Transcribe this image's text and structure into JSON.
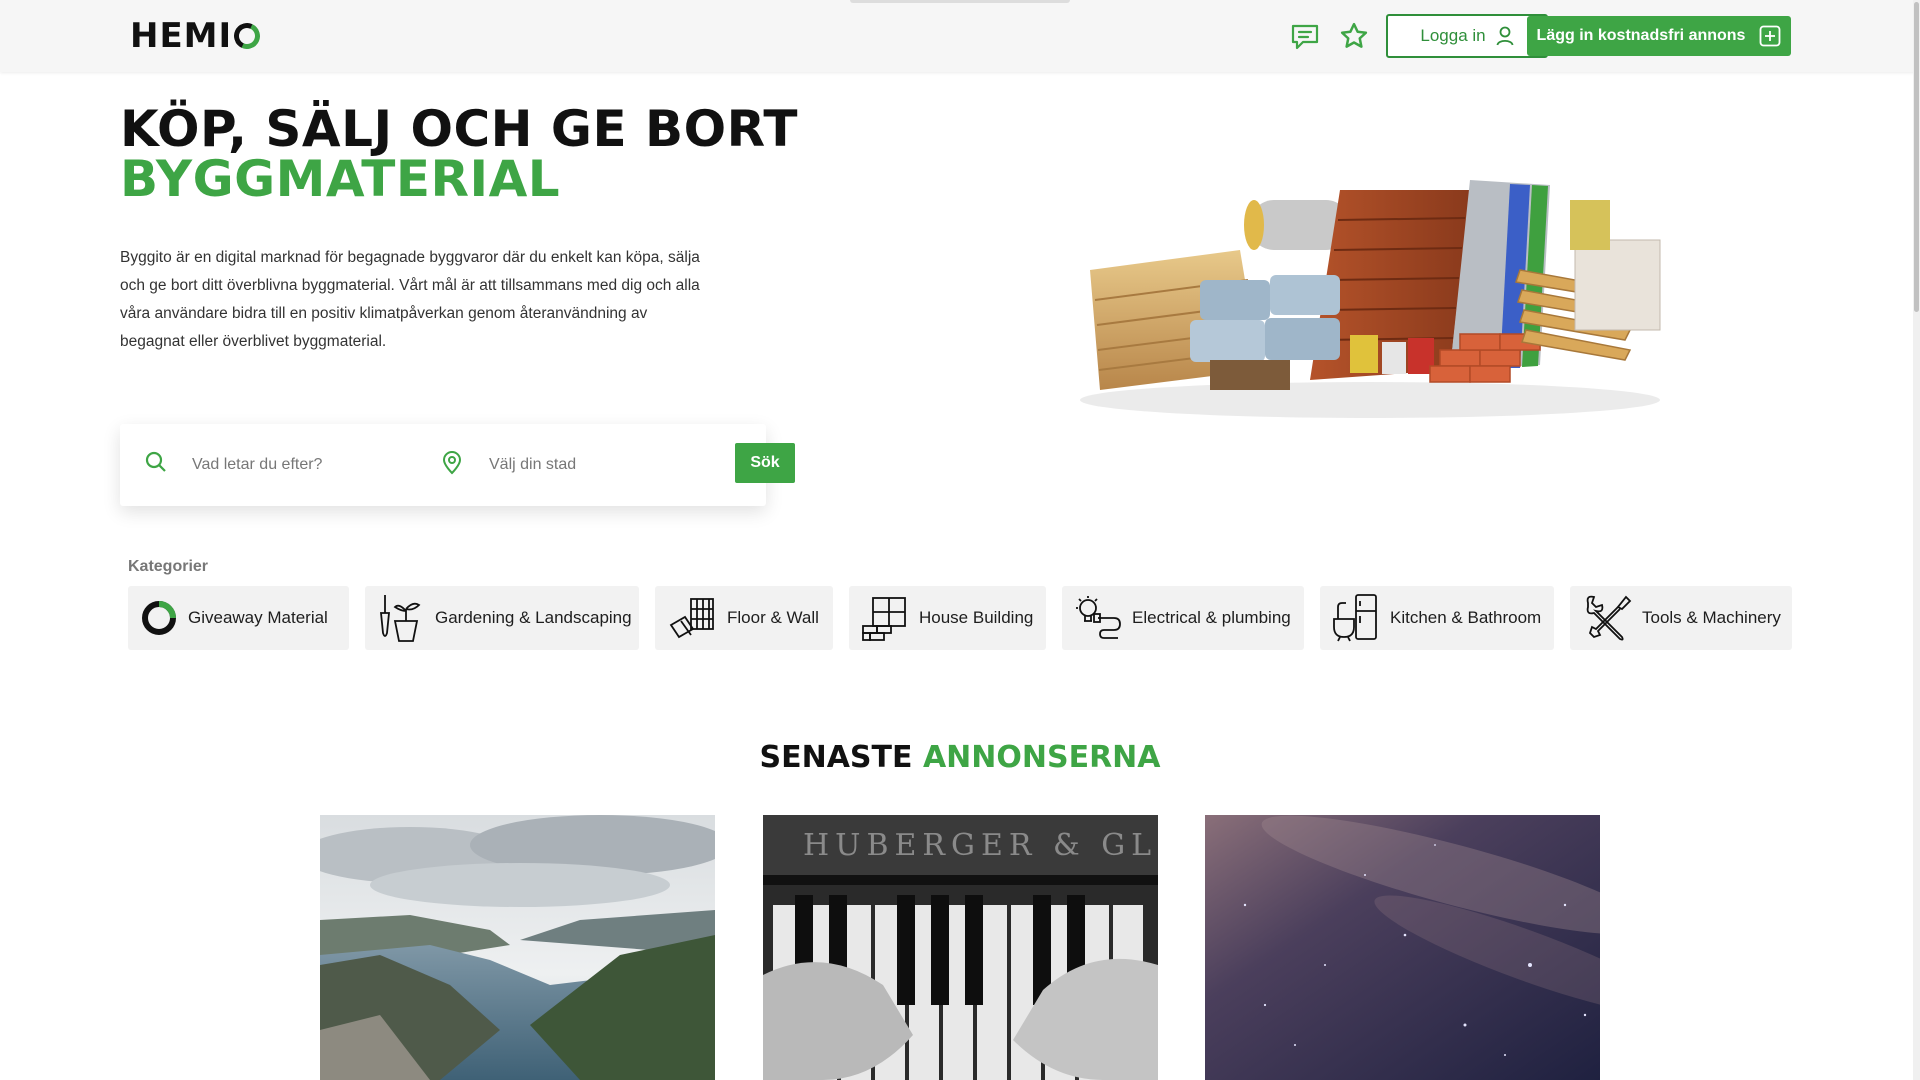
{
  "header": {
    "logo": "HEMI",
    "login_label": "Logga in",
    "post_ad_label": "Lägg in kostnadsfri annons"
  },
  "hero": {
    "title_line1": "KÖP, SÄLJ OCH GE BORT",
    "title_line2": "BYGGMATERIAL",
    "description": "Byggito är en digital marknad för begagnade byggvaror där du enkelt kan köpa, sälja och ge bort ditt överblivna byggmaterial. Vårt mål är att tillsammans med dig och alla våra användare bidra till en positiv klimatpåverkan genom återanvändning av begagnat eller överblivet byggmaterial."
  },
  "search": {
    "query_placeholder": "Vad letar du efter?",
    "city_placeholder": "Välj din stad",
    "button_label": "Sök"
  },
  "categories": {
    "heading": "Kategorier",
    "items": [
      {
        "label": "Giveaway Material",
        "icon": "giveaway-ring-icon"
      },
      {
        "label": "Gardening & Landscaping",
        "icon": "gardening-tools-icon"
      },
      {
        "label": "Floor & Wall",
        "icon": "floor-wall-icon"
      },
      {
        "label": "House Building",
        "icon": "house-building-icon"
      },
      {
        "label": "Electrical & plumbing",
        "icon": "electrical-plumbing-icon"
      },
      {
        "label": "Kitchen & Bathroom",
        "icon": "kitchen-bathroom-icon"
      },
      {
        "label": "Tools & Machinery",
        "icon": "tools-machinery-icon"
      }
    ]
  },
  "latest": {
    "title_part1": "SENASTE",
    "title_part2": "ANNONSERNA",
    "ads": [
      {
        "image": "fjord-landscape"
      },
      {
        "image": "piano-hands"
      },
      {
        "image": "night-sky"
      }
    ]
  },
  "colors": {
    "accent": "#3ea545",
    "accent_dark": "#2f8f3a",
    "header_bg": "#f6f6f6",
    "category_bg": "#f2f2f2"
  }
}
